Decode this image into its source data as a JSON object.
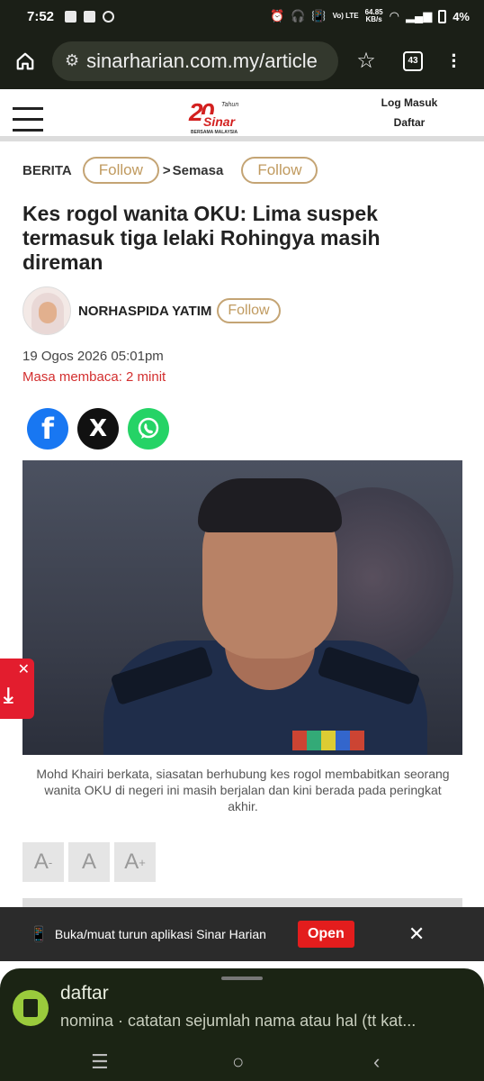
{
  "status_bar": {
    "time": "7:52",
    "net_speed_value": "64.85",
    "net_speed_unit": "KB/s",
    "network_label": "Vo) LTE",
    "battery": "4%"
  },
  "browser": {
    "url": "sinarharian.com.my/article",
    "tab_count": "43"
  },
  "site_header": {
    "logo_number": "20",
    "logo_brand": "Sinar",
    "logo_tagline": "Tahun",
    "logo_sub": "BERSAMA MALAYSIA",
    "login": "Log Masuk",
    "register": "Daftar"
  },
  "breadcrumb": {
    "section": "BERITA",
    "follow_1": "Follow",
    "separator": ">",
    "subsection": "Semasa",
    "follow_2": "Follow"
  },
  "article": {
    "headline": "Kes rogol wanita OKU: Lima suspek termasuk tiga lelaki Rohingya masih direman",
    "author": "NORHASPIDA YATIM",
    "author_follow": "Follow",
    "date": "19 Ogos 2026 05:01pm",
    "read_time": "Masa membaca: 2 minit",
    "caption": "Mohd Khairi berkata, siasatan berhubung kes rogol membabitkan seorang wanita OKU di negeri ini masih berjalan dan kini berada pada peringkat akhir."
  },
  "share": {
    "facebook_glyph": "f",
    "x_glyph": "X"
  },
  "font_controls": {
    "decrease": "A",
    "decrease_sup": "-",
    "normal": "A",
    "increase": "A",
    "increase_sup": "+"
  },
  "app_banner": {
    "text": "Buka/muat turun aplikasi Sinar Harian",
    "open_label": "Open",
    "close_glyph": "✕"
  },
  "dictionary_sheet": {
    "word": "daftar",
    "definition": "nomina · catatan sejumlah nama atau hal (tt kat..."
  },
  "colors": {
    "accent_red": "#d32f2f",
    "follow_gold": "#c09a5f",
    "facebook": "#1877f2",
    "whatsapp": "#25d366"
  }
}
